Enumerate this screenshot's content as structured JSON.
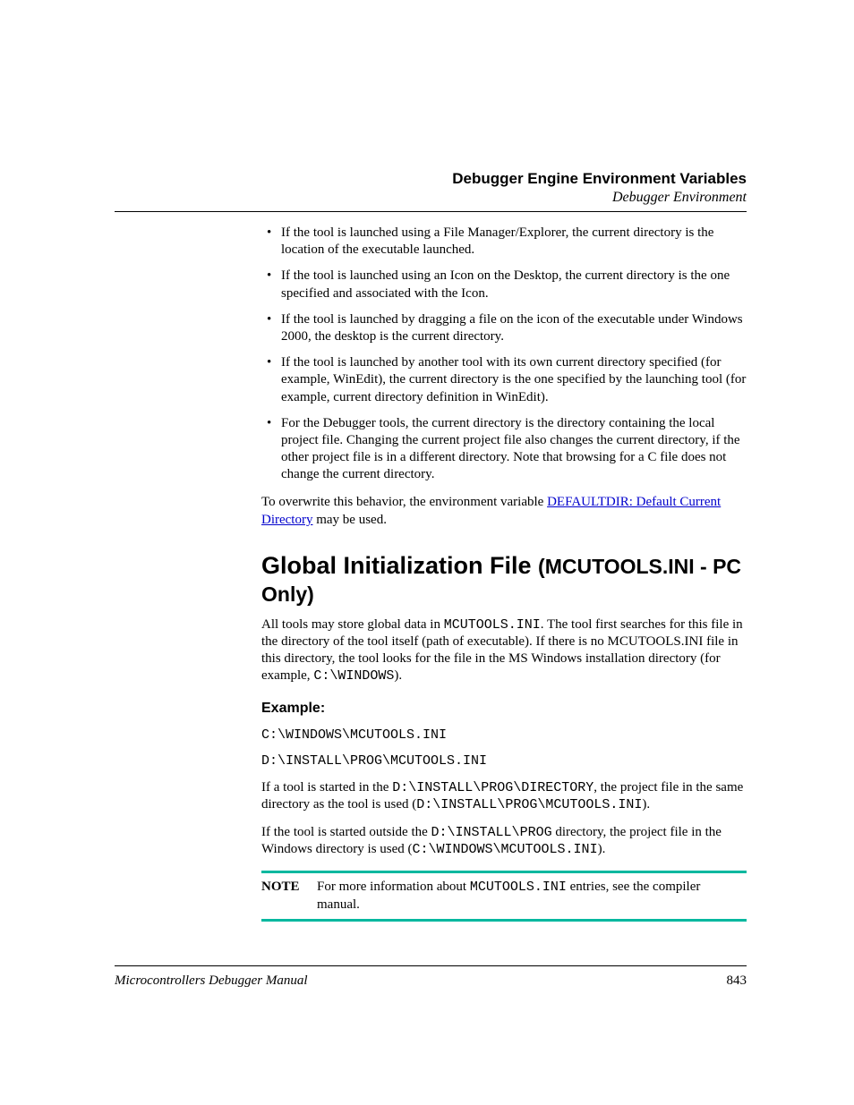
{
  "header": {
    "title": "Debugger Engine Environment Variables",
    "subtitle": "Debugger Environment"
  },
  "bullets": [
    "If the tool is launched using a File Manager/Explorer, the current directory is the location of the executable launched.",
    "If the tool is launched using an Icon on the Desktop, the current directory is the one specified and associated with the Icon.",
    "If the tool is launched by dragging a file on the icon of the executable under Windows 2000, the desktop is the current directory.",
    "If the tool is launched by another tool with its own current directory specified (for example, WinEdit), the current directory is the one specified by the launching tool (for example, current directory definition in WinEdit).",
    "For the Debugger tools, the current directory is the directory containing the local project file. Changing the current project file also changes the current directory, if the other project file is in a different directory. Note that browsing for a C file does not change the current directory."
  ],
  "overwrite": {
    "pre": "To overwrite this behavior, the environment variable ",
    "link": "DEFAULTDIR: Default Current Directory",
    "post": " may be used."
  },
  "section": {
    "title_main": "Global Initialization File ",
    "title_paren": "(MCUTOOLS.INI - PC Only)"
  },
  "intro": {
    "pre": "All tools may store global data in ",
    "code": "MCUTOOLS.INI",
    "mid": ". The tool first searches for this file in the directory of the tool itself (path of executable). If there is no MCUTOOLS.INI file in this directory, the tool looks for the file in the MS Windows installation directory (for example, ",
    "code2": "C:\\WINDOWS",
    "post": ")."
  },
  "example_heading": "Example:",
  "code_lines": [
    "C:\\WINDOWS\\MCUTOOLS.INI",
    "D:\\INSTALL\\PROG\\MCUTOOLS.INI"
  ],
  "p1": {
    "t1": "If a tool is started in the ",
    "c1": "D:\\INSTALL\\PROG\\DIRECTORY",
    "t2": ", the project file in the same directory as the tool is used (",
    "c2": "D:\\INSTALL\\PROG\\MCUTOOLS.INI",
    "t3": ")."
  },
  "p2": {
    "t1": "If the tool is started outside the ",
    "c1": "D:\\INSTALL\\PROG",
    "t2": " directory, the project file in the Windows directory is used (",
    "c2": "C:\\WINDOWS\\MCUTOOLS.INI",
    "t3": ")."
  },
  "note": {
    "label": "NOTE",
    "t1": "For more information about ",
    "c1": "MCUTOOLS.INI",
    "t2": " entries, see the compiler manual."
  },
  "footer": {
    "title": "Microcontrollers Debugger Manual",
    "page": "843"
  }
}
